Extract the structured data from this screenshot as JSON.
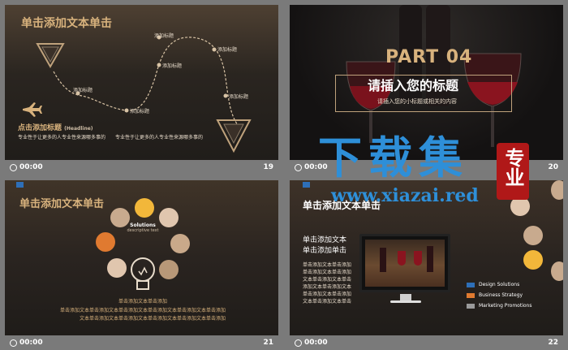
{
  "slides": [
    {
      "number": "19",
      "time": "00:00",
      "title": "单击添加文本单击",
      "node_labels": [
        "添加标题",
        "添加标题",
        "添加标题",
        "添加标题",
        "添加标题",
        "添加标题"
      ],
      "heading": "点击添加标题",
      "heading_en": "(Headline)",
      "desc_left": "专业性于让更多的人专业性来源哪多事的",
      "desc_right": "专业性于让更多的人专业性来源哪多事的"
    },
    {
      "number": "20",
      "time": "00:00",
      "part": "PART 04",
      "title": "请插入您的标题",
      "subtitle": "请插入您的小标题或相关的内容"
    },
    {
      "number": "21",
      "time": "00:00",
      "title": "单击添加文本单击",
      "solutions_title": "Solutions",
      "solutions_text": "descriptive text",
      "text_lines": [
        "单击添加文本单击添加",
        "单击添加文本单击添加文本单击添加文本单击添加文本单击添加文本单击添加",
        "文本单击添加文本单击添加文本单击添加文本单击添加文本单击添加"
      ],
      "circle_colors": [
        "#f2b73a",
        "#e0c6ae",
        "#c8aa8e",
        "#e07a30",
        "#c9a98a",
        "#e0c6ae",
        "#b89878",
        "#d8bca0"
      ]
    },
    {
      "number": "22",
      "time": "00:00",
      "title": "单击添加文本单击",
      "left_line1": "单击添加文本",
      "left_line2": "单击添加单击",
      "left_body": [
        "单击添加文本单击添加",
        "单击添加文本单击添加",
        "文本单击添加文本单击",
        "添加文本单击添加文本",
        "单击添加文本单击添加",
        "文本单击添加文本单击"
      ],
      "legend": [
        {
          "label": "Design Solutions",
          "color": "#2e6fb8"
        },
        {
          "label": "Business Strategy",
          "color": "#e07a30"
        },
        {
          "label": "Marketing Promotions",
          "color": "#9a9a9a"
        }
      ]
    }
  ],
  "watermark": {
    "cn": "下载集",
    "seal": "专业",
    "url": "www.xiazai.red"
  }
}
